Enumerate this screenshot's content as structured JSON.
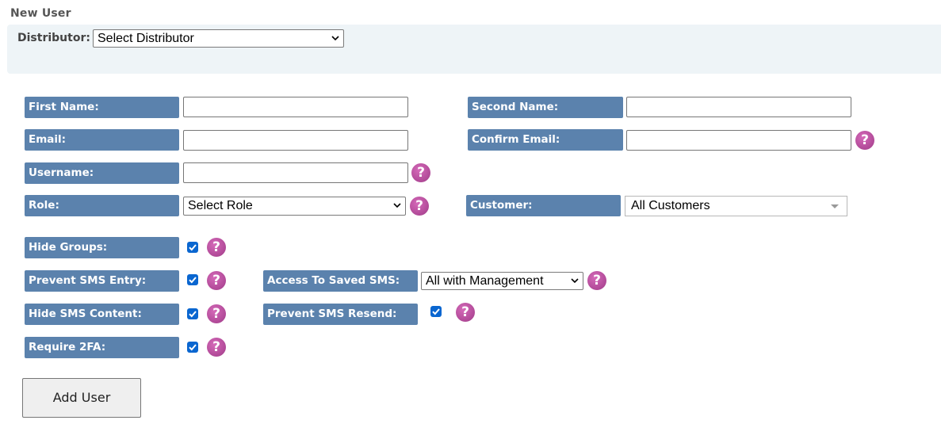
{
  "page": {
    "title": "New User"
  },
  "distributor": {
    "label": "Distributor:",
    "selected": "Select Distributor"
  },
  "fields": {
    "first_name": {
      "label": "First Name:",
      "value": ""
    },
    "second_name": {
      "label": "Second Name:",
      "value": ""
    },
    "email": {
      "label": "Email:",
      "value": ""
    },
    "confirm_email": {
      "label": "Confirm Email:",
      "value": ""
    },
    "username": {
      "label": "Username:",
      "value": ""
    },
    "role": {
      "label": "Role:",
      "selected": "Select Role"
    },
    "customer": {
      "label": "Customer:",
      "selected": "All Customers"
    },
    "hide_groups": {
      "label": "Hide Groups:",
      "checked": true
    },
    "prevent_sms_entry": {
      "label": "Prevent SMS Entry:",
      "checked": true
    },
    "access_saved_sms": {
      "label": "Access To Saved SMS:",
      "selected": "All with Management"
    },
    "hide_sms_content": {
      "label": "Hide SMS Content:",
      "checked": true
    },
    "prevent_sms_resend": {
      "label": "Prevent SMS Resend:",
      "checked": true
    },
    "require_2fa": {
      "label": "Require 2FA:",
      "checked": true
    }
  },
  "help": {
    "glyph": "?"
  },
  "actions": {
    "add_user": "Add User"
  },
  "colors": {
    "label_bg": "#5b82ad",
    "help_bg": "#b04997",
    "checkbox": "#0a66d0",
    "panel_bg": "#eef4f7"
  }
}
